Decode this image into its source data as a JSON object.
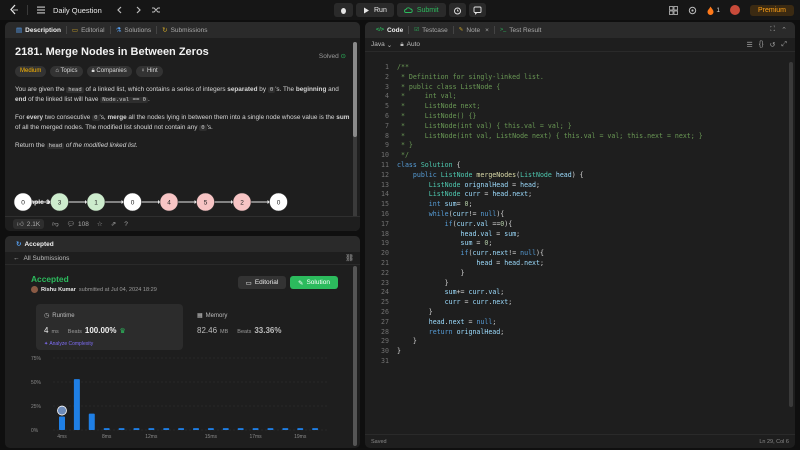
{
  "topbar": {
    "title": "Daily Question",
    "run_label": "Run",
    "submit_label": "Submit",
    "streak": "1",
    "premium_label": "Premium"
  },
  "description_panel": {
    "tabs": [
      {
        "label": "Description",
        "icon": "document-icon"
      },
      {
        "label": "Editorial",
        "icon": "book-icon"
      },
      {
        "label": "Solutions",
        "icon": "flask-icon"
      },
      {
        "label": "Submissions",
        "icon": "history-icon"
      }
    ],
    "title": "2181. Merge Nodes in Between Zeros",
    "solved_label": "Solved",
    "tags": [
      "Medium",
      "Topics",
      "Companies",
      "Hint"
    ],
    "p1": {
      "a": "You are given the ",
      "code1": "head",
      "b": " of a linked list, which contains a series of integers ",
      "bold1": "separated",
      "c": " by ",
      "code2": "0",
      "d": "'s. The ",
      "bold2": "beginning",
      "e": " and ",
      "bold3": "end",
      "f": " of the linked list will have ",
      "code3": "Node.val == 0",
      "g": "."
    },
    "p2": {
      "a": "For ",
      "bold1": "every",
      "b": " two consecutive ",
      "code1": "0",
      "c": "'s, ",
      "bold2": "merge",
      "d": " all the nodes lying in between them into a single node whose value is the ",
      "bold3": "sum",
      "e": " of all the merged nodes. The modified list should not contain any ",
      "code2": "0",
      "f": "'s."
    },
    "p3": {
      "a": "Return the ",
      "code1": "head",
      "b": " of the modified linked list."
    },
    "example_title": "Example 1:",
    "nodes": [
      {
        "value": "0",
        "color": "#ffffff"
      },
      {
        "value": "3",
        "color": "#cdeccd"
      },
      {
        "value": "1",
        "color": "#cdeccd"
      },
      {
        "value": "0",
        "color": "#ffffff"
      },
      {
        "value": "4",
        "color": "#f7c4c4"
      },
      {
        "value": "5",
        "color": "#f7c4c4"
      },
      {
        "value": "2",
        "color": "#f7c4c4"
      },
      {
        "value": "0",
        "color": "#ffffff"
      }
    ],
    "likes": "2.1K",
    "comments": "108"
  },
  "accepted_panel": {
    "tab_label": "Accepted",
    "back_label": "All Submissions",
    "status": "Accepted",
    "user_name": "Rishu Kumar",
    "submitted_text": "submitted at Jul 04, 2024 18:29",
    "editorial_label": "Editorial",
    "solution_label": "Solution",
    "runtime": {
      "label": "Runtime",
      "value": "4",
      "unit": "ms",
      "beats_label": "Beats",
      "beats_value": "100.00%",
      "analyze_label": "Analyze Complexity"
    },
    "memory": {
      "label": "Memory",
      "value": "82.46",
      "unit": "MB",
      "beats_label": "Beats",
      "beats_value": "33.36%"
    }
  },
  "chart_data": {
    "type": "bar",
    "y_ticks": [
      "75%",
      "50%",
      "25%",
      "0%"
    ],
    "ylim": [
      0,
      75
    ],
    "x_tick_labels": [
      "4ms",
      "8ms",
      "12ms",
      "15ms",
      "17ms",
      "19ms"
    ],
    "values": [
      14,
      53,
      17,
      2,
      2,
      2,
      2,
      2,
      2,
      2,
      2,
      2,
      2,
      2,
      2,
      2,
      2,
      2
    ],
    "highlight_index": 0,
    "bar_color": "#1f7fe5"
  },
  "editor": {
    "tabs": [
      {
        "label": "Code",
        "icon": "code-icon"
      },
      {
        "label": "Testcase",
        "icon": "checkbox-icon"
      },
      {
        "label": "Note",
        "icon": "note-icon"
      },
      {
        "label": "Test Result",
        "icon": "terminal-icon"
      }
    ],
    "language": "Java",
    "mode": "Auto",
    "status_left": "Saved",
    "status_right": "Ln 29, Col 6",
    "lines": [
      {
        "n": "1",
        "tokens": [
          [
            "c-com",
            "/**"
          ]
        ]
      },
      {
        "n": "2",
        "tokens": [
          [
            "c-com",
            " * Definition for singly-linked list."
          ]
        ]
      },
      {
        "n": "3",
        "tokens": [
          [
            "c-com",
            " * public class ListNode {"
          ]
        ]
      },
      {
        "n": "4",
        "tokens": [
          [
            "c-com",
            " *     int val;"
          ]
        ]
      },
      {
        "n": "5",
        "tokens": [
          [
            "c-com",
            " *     ListNode next;"
          ]
        ]
      },
      {
        "n": "6",
        "tokens": [
          [
            "c-com",
            " *     ListNode() {}"
          ]
        ]
      },
      {
        "n": "7",
        "tokens": [
          [
            "c-com",
            " *     ListNode(int val) { this.val = val; }"
          ]
        ]
      },
      {
        "n": "8",
        "tokens": [
          [
            "c-com",
            " *     ListNode(int val, ListNode next) { this.val = val; this.next = next; }"
          ]
        ]
      },
      {
        "n": "9",
        "tokens": [
          [
            "c-com",
            " * }"
          ]
        ]
      },
      {
        "n": "10",
        "tokens": [
          [
            "c-com",
            " */"
          ]
        ]
      },
      {
        "n": "11",
        "tokens": [
          [
            "c-kw",
            "class "
          ],
          [
            "c-ty",
            "Solution"
          ],
          [
            "c-pl",
            " {"
          ]
        ]
      },
      {
        "n": "12",
        "tokens": [
          [
            "c-pl",
            "    "
          ],
          [
            "c-kw",
            "public "
          ],
          [
            "c-ty",
            "ListNode "
          ],
          [
            "c-fn",
            "mergeNodes"
          ],
          [
            "c-pl",
            "("
          ],
          [
            "c-ty",
            "ListNode "
          ],
          [
            "c-id",
            "head"
          ],
          [
            "c-pl",
            ") {"
          ]
        ]
      },
      {
        "n": "13",
        "tokens": [
          [
            "c-pl",
            "        "
          ],
          [
            "c-ty",
            "ListNode "
          ],
          [
            "c-id",
            "orignalHead"
          ],
          [
            "c-pl",
            " = "
          ],
          [
            "c-id",
            "head"
          ],
          [
            "c-pl",
            ";"
          ]
        ]
      },
      {
        "n": "14",
        "tokens": [
          [
            "c-pl",
            "        "
          ],
          [
            "c-ty",
            "ListNode "
          ],
          [
            "c-id",
            "curr"
          ],
          [
            "c-pl",
            " = "
          ],
          [
            "c-id",
            "head"
          ],
          [
            "c-pl",
            "."
          ],
          [
            "c-id",
            "next"
          ],
          [
            "c-pl",
            ";"
          ]
        ]
      },
      {
        "n": "15",
        "tokens": [
          [
            "c-pl",
            "        "
          ],
          [
            "c-kw",
            "int "
          ],
          [
            "c-id",
            "sum"
          ],
          [
            "c-pl",
            "= "
          ],
          [
            "c-num",
            "0"
          ],
          [
            "c-pl",
            ";"
          ]
        ]
      },
      {
        "n": "16",
        "tokens": [
          [
            "c-pl",
            "        "
          ],
          [
            "c-kw",
            "while"
          ],
          [
            "c-pl",
            "("
          ],
          [
            "c-id",
            "curr"
          ],
          [
            "c-pl",
            "!= "
          ],
          [
            "c-kw",
            "null"
          ],
          [
            "c-pl",
            "){"
          ]
        ]
      },
      {
        "n": "17",
        "tokens": [
          [
            "c-pl",
            "            "
          ],
          [
            "c-kw",
            "if"
          ],
          [
            "c-pl",
            "("
          ],
          [
            "c-id",
            "curr"
          ],
          [
            "c-pl",
            "."
          ],
          [
            "c-id",
            "val"
          ],
          [
            "c-pl",
            " =="
          ],
          [
            "c-num",
            "0"
          ],
          [
            "c-pl",
            "){"
          ]
        ]
      },
      {
        "n": "18",
        "tokens": [
          [
            "c-pl",
            "                "
          ],
          [
            "c-id",
            "head"
          ],
          [
            "c-pl",
            "."
          ],
          [
            "c-id",
            "val"
          ],
          [
            "c-pl",
            " = "
          ],
          [
            "c-id",
            "sum"
          ],
          [
            "c-pl",
            ";"
          ]
        ]
      },
      {
        "n": "19",
        "tokens": [
          [
            "c-pl",
            "                "
          ],
          [
            "c-id",
            "sum"
          ],
          [
            "c-pl",
            " = "
          ],
          [
            "c-num",
            "0"
          ],
          [
            "c-pl",
            ";"
          ]
        ]
      },
      {
        "n": "20",
        "tokens": [
          [
            "c-pl",
            "                "
          ],
          [
            "c-kw",
            "if"
          ],
          [
            "c-pl",
            "("
          ],
          [
            "c-id",
            "curr"
          ],
          [
            "c-pl",
            "."
          ],
          [
            "c-id",
            "next"
          ],
          [
            "c-pl",
            "!= "
          ],
          [
            "c-kw",
            "null"
          ],
          [
            "c-pl",
            "){"
          ]
        ]
      },
      {
        "n": "21",
        "tokens": [
          [
            "c-pl",
            "                    "
          ],
          [
            "c-id",
            "head"
          ],
          [
            "c-pl",
            " = "
          ],
          [
            "c-id",
            "head"
          ],
          [
            "c-pl",
            "."
          ],
          [
            "c-id",
            "next"
          ],
          [
            "c-pl",
            ";"
          ]
        ]
      },
      {
        "n": "22",
        "tokens": [
          [
            "c-pl",
            "                }"
          ]
        ]
      },
      {
        "n": "23",
        "tokens": [
          [
            "c-pl",
            "            }"
          ]
        ]
      },
      {
        "n": "24",
        "tokens": [
          [
            "c-pl",
            "            "
          ],
          [
            "c-id",
            "sum"
          ],
          [
            "c-pl",
            "+= "
          ],
          [
            "c-id",
            "curr"
          ],
          [
            "c-pl",
            "."
          ],
          [
            "c-id",
            "val"
          ],
          [
            "c-pl",
            ";"
          ]
        ]
      },
      {
        "n": "25",
        "tokens": [
          [
            "c-pl",
            "            "
          ],
          [
            "c-id",
            "curr"
          ],
          [
            "c-pl",
            " = "
          ],
          [
            "c-id",
            "curr"
          ],
          [
            "c-pl",
            "."
          ],
          [
            "c-id",
            "next"
          ],
          [
            "c-pl",
            ";"
          ]
        ]
      },
      {
        "n": "26",
        "tokens": [
          [
            "c-pl",
            "        }"
          ]
        ]
      },
      {
        "n": "27",
        "tokens": [
          [
            "c-pl",
            "        "
          ],
          [
            "c-id",
            "head"
          ],
          [
            "c-pl",
            "."
          ],
          [
            "c-id",
            "next"
          ],
          [
            "c-pl",
            " = "
          ],
          [
            "c-kw",
            "null"
          ],
          [
            "c-pl",
            ";"
          ]
        ]
      },
      {
        "n": "28",
        "tokens": [
          [
            "c-pl",
            "        "
          ],
          [
            "c-kw",
            "return "
          ],
          [
            "c-id",
            "orignalHead"
          ],
          [
            "c-pl",
            ";"
          ]
        ]
      },
      {
        "n": "29",
        "tokens": [
          [
            "c-pl",
            "    }"
          ]
        ]
      },
      {
        "n": "30",
        "tokens": [
          [
            "c-pl",
            "}"
          ]
        ]
      },
      {
        "n": "31",
        "tokens": []
      }
    ]
  }
}
